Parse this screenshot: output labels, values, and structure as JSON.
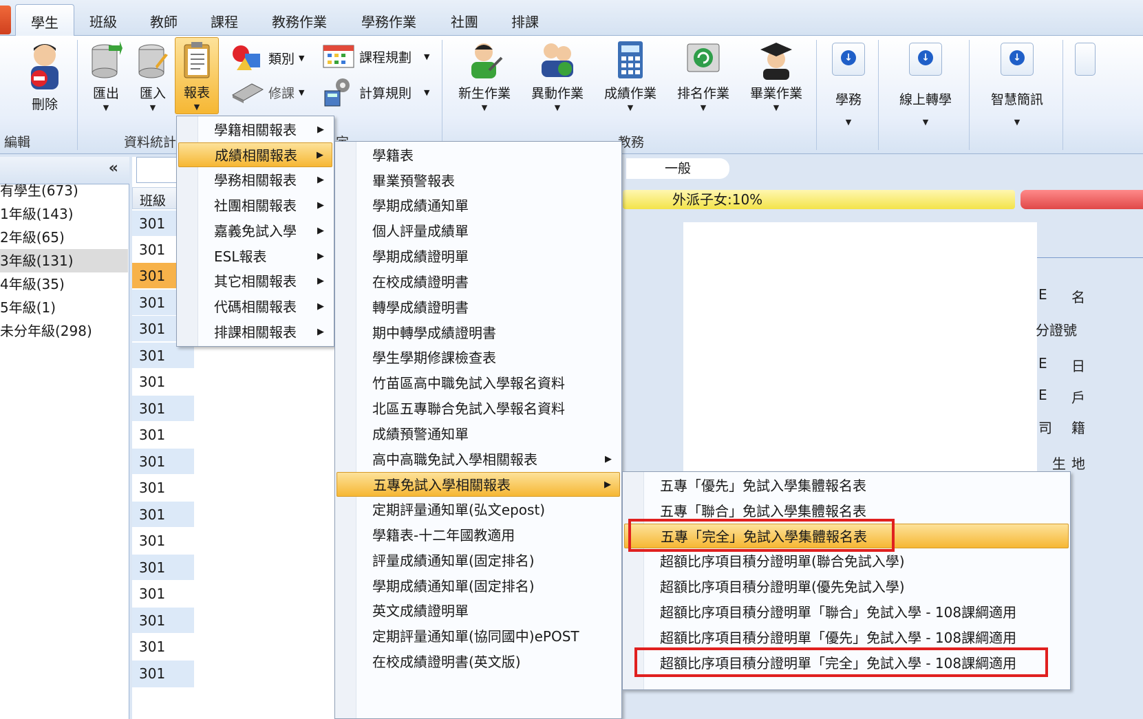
{
  "tabs": [
    "學生",
    "班級",
    "教師",
    "課程",
    "教務作業",
    "學務作業",
    "社團",
    "排課"
  ],
  "ribbon": {
    "edit_group": {
      "label": "編輯",
      "delete": "刪除"
    },
    "data_group": {
      "label": "資料統計",
      "export": "匯出",
      "import": "匯入",
      "report": "報表"
    },
    "settings_group": {
      "label_fragment": "定",
      "category": "類別",
      "course_plan": "課程規劃",
      "repair": "修課",
      "calc_rule": "計算規則"
    },
    "academic_group": {
      "label": "教務",
      "new_student": "新生作業",
      "change": "異動作業",
      "score": "成績作業",
      "ranking": "排名作業",
      "graduation": "畢業作業"
    },
    "extra": {
      "student_affairs": "學務",
      "online_transfer": "線上轉學",
      "smart_sms": "智慧簡訊"
    }
  },
  "left_panel": {
    "collapse": "«",
    "tree": [
      "有學生(673)",
      "1年級(143)",
      "2年級(65)",
      "3年級(131)",
      "4年級(35)",
      "5年級(1)",
      "未分年級(298)"
    ]
  },
  "grid": {
    "header": "班級",
    "rows": [
      "301",
      "301",
      "301",
      "301",
      "301",
      "301",
      "301",
      "301",
      "301",
      "301",
      "301",
      "301",
      "301",
      "301",
      "301",
      "301",
      "301",
      "301"
    ]
  },
  "content": {
    "tag": "一般",
    "note": "外派子女:10%",
    "fragments": [
      "E",
      "名",
      "分證號",
      "E",
      "日",
      "E",
      "戶",
      "司",
      "籍",
      "生",
      "地"
    ]
  },
  "menu1": {
    "items": [
      "學籍相關報表",
      "成績相關報表",
      "學務相關報表",
      "社團相關報表",
      "嘉義免試入學",
      "ESL報表",
      "其它相關報表",
      "代碼相關報表",
      "排課相關報表"
    ],
    "active_index": 1
  },
  "menu2": {
    "items": [
      "學籍表",
      "畢業預警報表",
      "學期成績通知單",
      "個人評量成績單",
      "學期成績證明單",
      "在校成績證明書",
      "轉學成績證明書",
      "期中轉學成績證明書",
      "學生學期修課檢查表",
      "竹苗區高中職免試入學報名資料",
      "北區五專聯合免試入學報名資料",
      "成績預警通知單",
      "高中高職免試入學相關報表",
      "五專免試入學相關報表",
      "定期評量通知單(弘文epost)",
      "學籍表-十二年國教適用",
      "評量成績通知單(固定排名)",
      "學期成績通知單(固定排名)",
      "英文成績證明單",
      "定期評量通知單(協同國中)ePOST",
      "在校成績證明書(英文版)"
    ],
    "active_index": 13
  },
  "menu3": {
    "items": [
      "五專「優先」免試入學集體報名表",
      "五專「聯合」免試入學集體報名表",
      "五專「完全」免試入學集體報名表",
      "超額比序項目積分證明單(聯合免試入學)",
      "超額比序項目積分證明單(優先免試入學)",
      "超額比序項目積分證明單「聯合」免試入學 - 108課綱適用",
      "超額比序項目積分證明單「優先」免試入學 - 108課綱適用",
      "超額比序項目積分證明單「完全」免試入學 - 108課綱適用"
    ],
    "active_index": 2
  },
  "colors": {
    "highlight": "#f6b733",
    "annotation": "#e0201f",
    "ribbon_bg": "#dbe6f4"
  }
}
